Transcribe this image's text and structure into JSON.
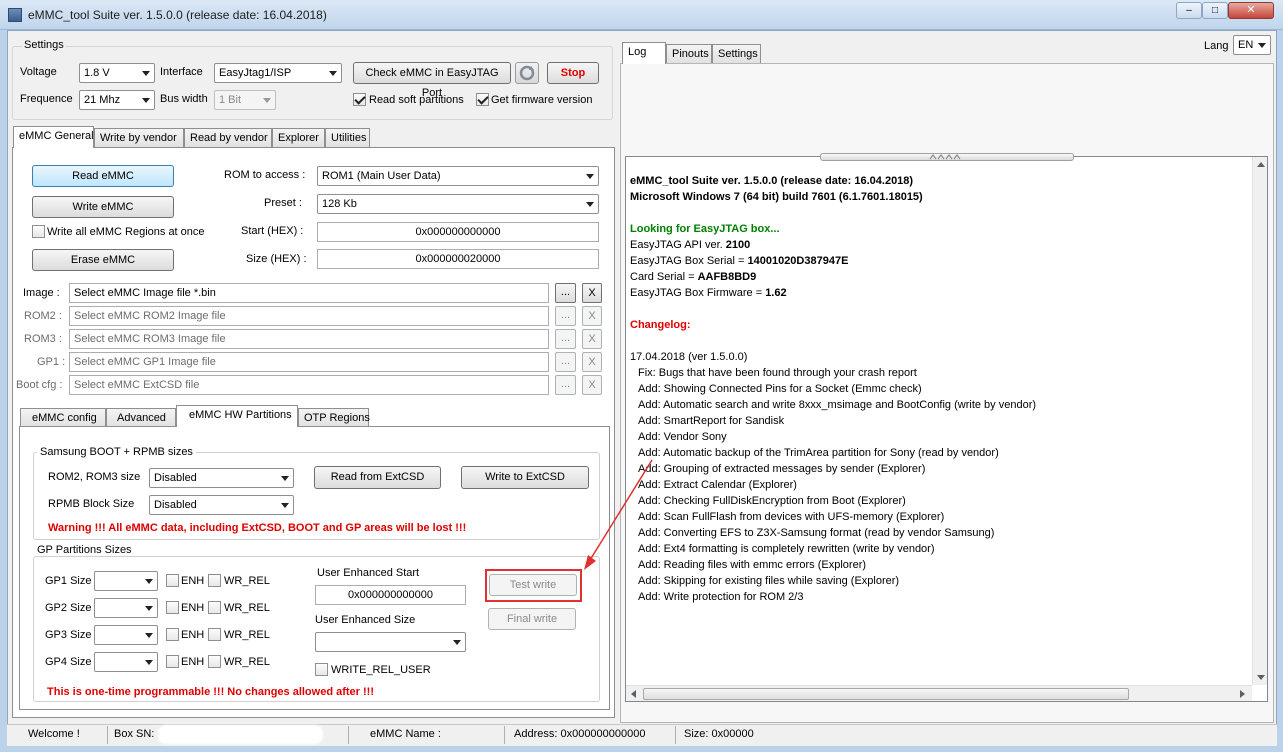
{
  "window": {
    "title": "eMMC_tool Suite  ver. 1.5.0.0 (release date: 16.04.2018)",
    "controls": {
      "min": "–",
      "max": "□",
      "close": "✕"
    }
  },
  "settings": {
    "title": "Settings",
    "voltage_label": "Voltage",
    "voltage": "1.8 V",
    "interface_label": "Interface",
    "interface": "EasyJtag1/ISP",
    "check_button": "Check eMMC in EasyJTAG Port",
    "stop_button": "Stop",
    "frequence_label": "Frequence",
    "frequence": "21 Mhz",
    "bus_width_label": "Bus width",
    "bus_width": "1 Bit",
    "read_soft_partitions": "Read soft partitions",
    "get_firmware_version": "Get firmware version"
  },
  "main_tabs": [
    "eMMC General",
    "Write by vendor",
    "Read by vendor",
    "Explorer",
    "Utilities"
  ],
  "general": {
    "read_button": "Read eMMC",
    "write_button": "Write eMMC",
    "write_all_regions": "Write all eMMC Regions at once",
    "erase_button": "Erase eMMC",
    "rom_label": "ROM to access :",
    "rom_value": "ROM1 (Main User Data)",
    "preset_label": "Preset :",
    "preset_value": "128 Kb",
    "start_label": "Start (HEX) :",
    "start_value": "0x000000000000",
    "size_label": "Size (HEX) :",
    "size_value": "0x000000020000"
  },
  "images": [
    {
      "label": "Image  :",
      "placeholder": "Select eMMC Image file *.bin",
      "browse": "...",
      "clear": "X"
    },
    {
      "label": "ROM2  :",
      "placeholder": "Select eMMC ROM2 Image file",
      "browse": "...",
      "clear": "X"
    },
    {
      "label": "ROM3  :",
      "placeholder": "Select eMMC ROM3 Image file",
      "browse": "...",
      "clear": "X"
    },
    {
      "label": "GP1 :",
      "placeholder": "Select eMMC GP1 Image file",
      "browse": "...",
      "clear": "X"
    },
    {
      "label": "Boot cfg :",
      "placeholder": "Select eMMC ExtCSD file",
      "browse": "...",
      "clear": "X"
    }
  ],
  "sub_tabs": [
    "eMMC config",
    "Advanced",
    "eMMC HW Partitions",
    "OTP Regions"
  ],
  "hw": {
    "samsung_group": "Samsung BOOT + RPMB sizes",
    "rom23_label": "ROM2, ROM3 size",
    "rom23_value": "Disabled",
    "rpmb_label": "RPMB Block Size",
    "rpmb_value": "Disabled",
    "read_extcsd": "Read from ExtCSD",
    "write_extcsd": "Write to ExtCSD",
    "warning": "Warning !!! All eMMC data, including ExtCSD, BOOT and GP areas will be lost !!!",
    "gp_group": "GP Partitions Sizes",
    "gp_rows": [
      {
        "label": "GP1 Size"
      },
      {
        "label": "GP2 Size"
      },
      {
        "label": "GP3 Size"
      },
      {
        "label": "GP4 Size"
      }
    ],
    "enh": "ENH",
    "wr_rel": "WR_REL",
    "ue_start_label": "User Enhanced Start",
    "ue_start_value": "0x000000000000",
    "ue_size_label": "User Enhanced Size",
    "write_rel_user": "WRITE_REL_USER",
    "test_write": "Test write",
    "final_write": "Final write",
    "otp_warning": "This is one-time programmable !!! No changes allowed after !!!"
  },
  "right_tabs": [
    "Log",
    "Pinouts",
    "Settings"
  ],
  "lang": {
    "label": "Lang",
    "value": "EN"
  },
  "log": {
    "title1": "eMMC_tool Suite  ver. 1.5.0.0 (release date: 16.04.2018)",
    "title2": "Microsoft Windows 7 (64 bit) build 7601 (6.1.7601.18015)",
    "looking": "Looking for EasyJTAG box...",
    "api_label": "EasyJTAG API ver. ",
    "api_value": "2100",
    "serial_label": "EasyJTAG Box Serial = ",
    "serial_value": "14001020D387947E",
    "card_label": "Card Serial = ",
    "card_value": "AAFB8BD9",
    "fw_label": "EasyJTAG Box Firmware = ",
    "fw_value": "1.62",
    "changelog": "Changelog:",
    "date_line": "17.04.2018 (ver 1.5.0.0)",
    "entries": [
      "Fix:   Bugs that have been found through your crash report",
      "Add:  Showing Connected Pins for a Socket (Emmc check)",
      "Add:  Automatic search and write 8xxx_msimage and BootConfig (write by vendor)",
      "Add:  SmartReport for Sandisk",
      "Add:  Vendor Sony",
      "Add:  Automatic backup of the TrimArea partition for Sony (read by vendor)",
      "Add:  Grouping of extracted messages by sender (Explorer)",
      "Add:  Extract Calendar (Explorer)",
      "Add:  Checking FullDiskEncryption from Boot (Explorer)",
      "Add:  Scan FullFlash from devices with UFS-memory (Explorer)",
      "Add:  Converting EFS to Z3X-Samsung format (read by vendor Samsung)",
      "Add:  Ext4 formatting is completely rewritten (write by vendor)",
      "Add:  Reading files with emmc errors (Explorer)",
      "Add:  Skipping for existing files while saving (Explorer)",
      "Add:  Write protection for ROM 2/3"
    ]
  },
  "status": {
    "welcome": "Welcome !",
    "box_sn": "Box SN:",
    "emmc_name": "eMMC Name :",
    "address": "Address: 0x000000000000",
    "size": "Size: 0x00000"
  },
  "colors": {
    "warning": "#e00000",
    "log_green": "#008000",
    "highlight": "#e03030"
  }
}
